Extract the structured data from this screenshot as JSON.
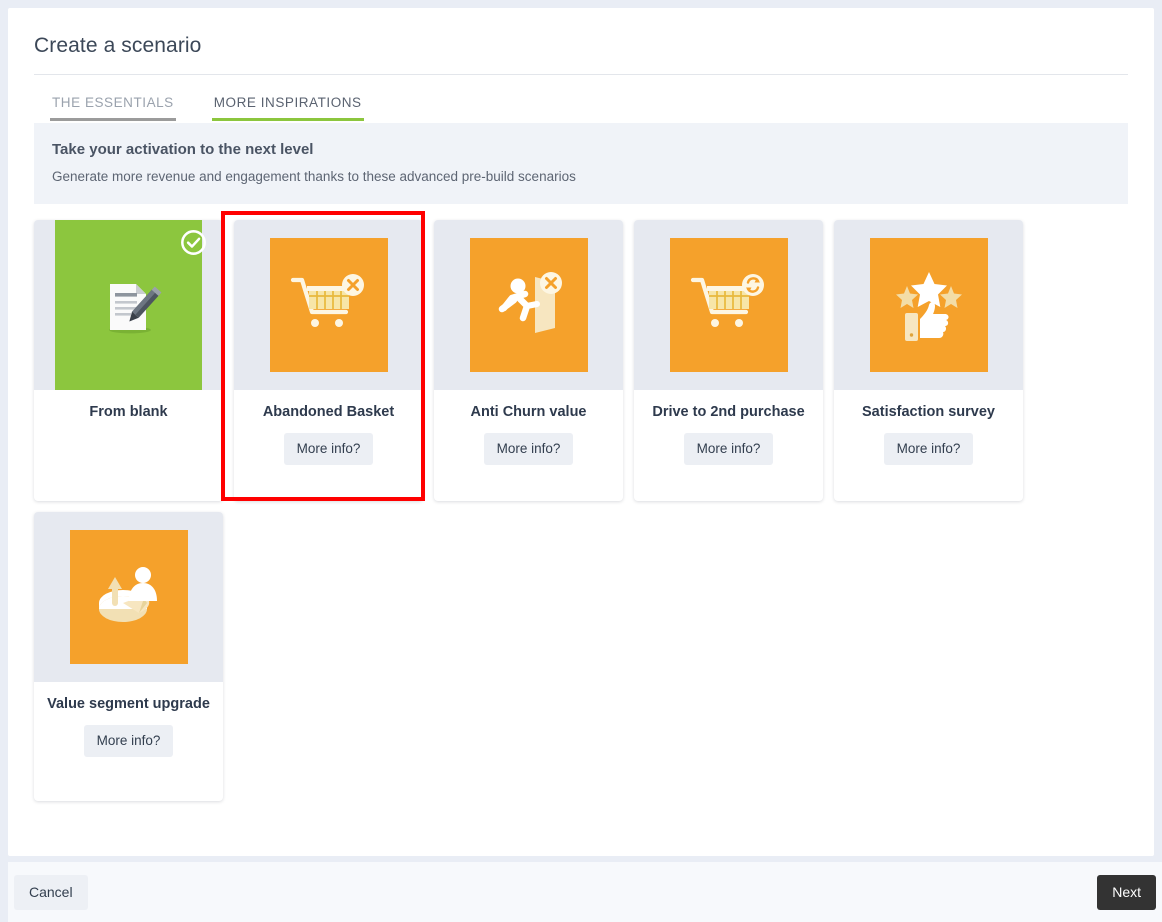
{
  "dialog": {
    "title": "Create a scenario"
  },
  "tabs": [
    {
      "label": "THE ESSENTIALS",
      "active": false
    },
    {
      "label": "MORE INSPIRATIONS",
      "active": true
    }
  ],
  "banner": {
    "title": "Take your activation to the next level",
    "subtitle": "Generate more revenue and engagement thanks to these advanced pre-build scenarios"
  },
  "cards": [
    {
      "title": "From blank",
      "icon": "document-pencil-icon",
      "thumb_color": "#8cc63e",
      "selected": true,
      "has_more_info": false,
      "more_info_label": "More info?"
    },
    {
      "title": "Abandoned Basket",
      "icon": "shopping-cart-x-icon",
      "thumb_color": "#f5a12b",
      "selected": false,
      "has_more_info": true,
      "more_info_label": "More info?",
      "highlighted": true
    },
    {
      "title": "Anti Churn value",
      "icon": "running-person-exit-x-icon",
      "thumb_color": "#f5a12b",
      "selected": false,
      "has_more_info": true,
      "more_info_label": "More info?"
    },
    {
      "title": "Drive to 2nd purchase",
      "icon": "shopping-cart-repeat-icon",
      "thumb_color": "#f5a12b",
      "selected": false,
      "has_more_info": true,
      "more_info_label": "More info?"
    },
    {
      "title": "Satisfaction survey",
      "icon": "thumbs-up-stars-icon",
      "thumb_color": "#f5a12b",
      "selected": false,
      "has_more_info": true,
      "more_info_label": "More info?"
    },
    {
      "title": "Value segment upgrade",
      "icon": "pie-chart-person-arrow-icon",
      "thumb_color": "#f5a12b",
      "selected": false,
      "has_more_info": true,
      "more_info_label": "More info?"
    }
  ],
  "footer": {
    "cancel_label": "Cancel",
    "next_label": "Next"
  },
  "colors": {
    "accent_green": "#8cc63e",
    "accent_orange": "#f5a12b",
    "thumb_bg": "#e6e9f0",
    "banner_bg": "#f0f3f8",
    "highlight_red": "#ff0000",
    "next_button": "#333333"
  }
}
